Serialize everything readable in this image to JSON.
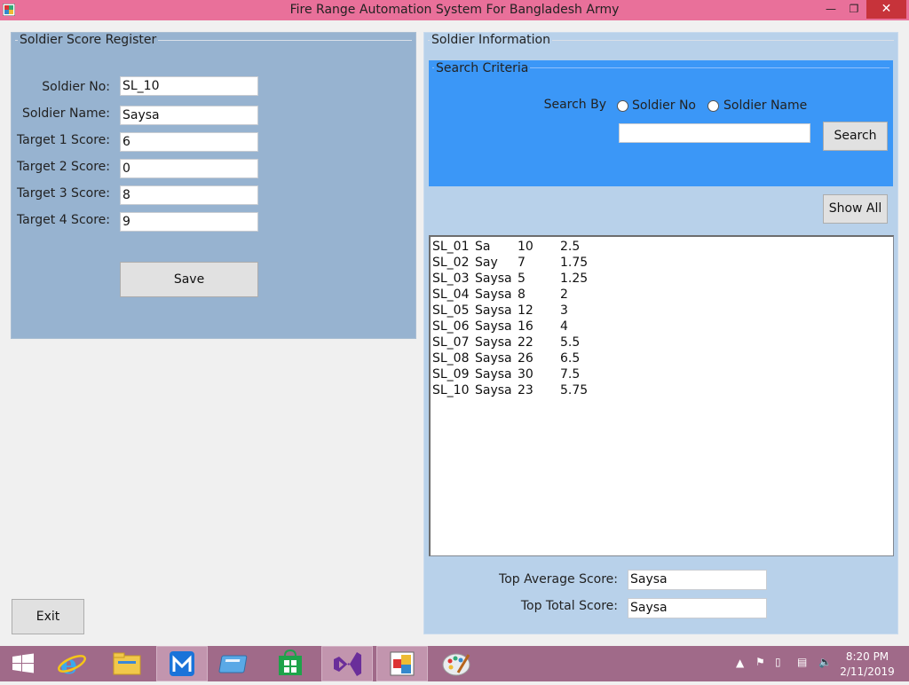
{
  "window": {
    "title": "Fire Range Automation System For Bangladesh Army",
    "minimize_glyph": "—",
    "maximize_glyph": "❐",
    "close_glyph": "✕"
  },
  "register": {
    "title": "Soldier Score Register",
    "fields": [
      {
        "label": "Soldier No:",
        "value": "SL_10"
      },
      {
        "label": "Soldier Name:",
        "value": "Saysa"
      },
      {
        "label": "Target 1 Score:",
        "value": "6"
      },
      {
        "label": "Target 2 Score:",
        "value": "0"
      },
      {
        "label": "Target 3 Score:",
        "value": "8"
      },
      {
        "label": "Target 4 Score:",
        "value": "9"
      }
    ],
    "save_label": "Save"
  },
  "exit_label": "Exit",
  "info": {
    "title": "Soldier Information",
    "search": {
      "title": "Search Criteria",
      "search_by_label": "Search By",
      "option_no": "Soldier No",
      "option_name": "Soldier Name",
      "query": "",
      "button_label": "Search"
    },
    "show_all_label": "Show All",
    "records": [
      [
        "SL_01",
        "Sa",
        "10",
        "2.5"
      ],
      [
        "SL_02",
        "Say",
        "7",
        "1.75"
      ],
      [
        "SL_03",
        "Saysa",
        "5",
        "1.25"
      ],
      [
        "SL_04",
        "Saysa",
        "8",
        "2"
      ],
      [
        "SL_05",
        "Saysa",
        "12",
        "3"
      ],
      [
        "SL_06",
        "Saysa",
        "16",
        "4"
      ],
      [
        "SL_07",
        "Saysa",
        "22",
        "5.5"
      ],
      [
        "SL_08",
        "Saysa",
        "26",
        "6.5"
      ],
      [
        "SL_09",
        "Saysa",
        "30",
        "7.5"
      ],
      [
        "SL_10",
        "Saysa",
        "23",
        "5.75"
      ]
    ],
    "top_average_label": "Top Average Score:",
    "top_average_value": "Saysa",
    "top_total_label": "Top Total Score:",
    "top_total_value": "Saysa"
  },
  "taskbar": {
    "items": [
      "start-icon",
      "internet-explorer-icon",
      "file-explorer-icon",
      "maxthon-browser-icon",
      "app-window-icon",
      "store-icon",
      "visual-studio-icon",
      "form-app-icon",
      "paint-icon"
    ],
    "time": "8:20 PM",
    "date": "2/11/2019"
  },
  "colors": {
    "titlebar": "#e9709a",
    "register_panel": "#97b3d0",
    "info_panel": "#b8d1ea",
    "search_panel": "#3b97f7",
    "taskbar": "#a06a89"
  }
}
